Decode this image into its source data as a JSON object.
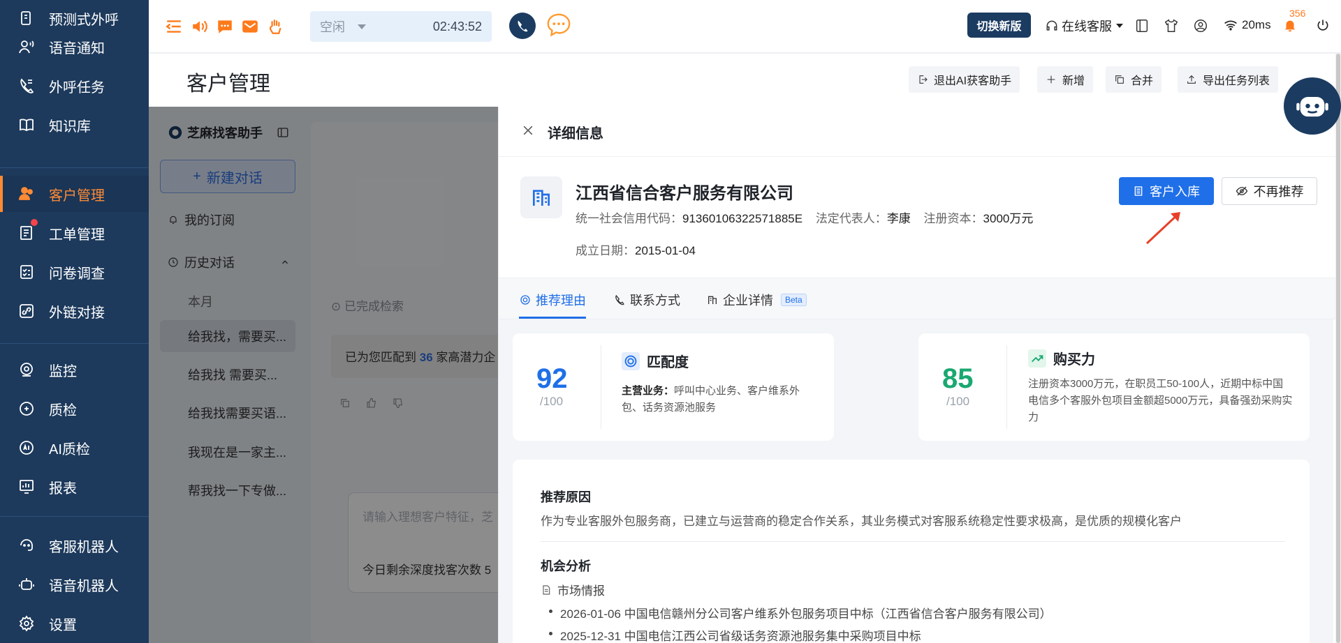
{
  "sidebar": {
    "items": [
      {
        "label": "预测式外呼",
        "icon": "predictive-dial-icon"
      },
      {
        "label": "语音通知",
        "icon": "voice-notice-icon"
      },
      {
        "label": "外呼任务",
        "icon": "outbound-task-icon"
      },
      {
        "label": "知识库",
        "icon": "book-icon"
      },
      {
        "label": "客户管理",
        "icon": "customers-icon",
        "active": true
      },
      {
        "label": "工单管理",
        "icon": "ticket-icon"
      },
      {
        "label": "问卷调查",
        "icon": "survey-icon"
      },
      {
        "label": "外链对接",
        "icon": "link-icon"
      },
      {
        "label": "监控",
        "icon": "monitor-icon"
      },
      {
        "label": "质检",
        "icon": "quality-icon"
      },
      {
        "label": "AI质检",
        "icon": "ai-quality-icon"
      },
      {
        "label": "报表",
        "icon": "report-icon"
      },
      {
        "label": "客服机器人",
        "icon": "service-bot-icon"
      },
      {
        "label": "语音机器人",
        "icon": "voice-bot-icon"
      },
      {
        "label": "设置",
        "icon": "gear-icon"
      }
    ]
  },
  "topbar": {
    "status": "空闲",
    "timer": "02:43:52",
    "switch_label": "切换新版",
    "online_service": "在线客服",
    "latency": "20ms",
    "notification_count": "356"
  },
  "header": {
    "title": "客户管理",
    "buttons": {
      "exit_ai": "退出AI获客助手",
      "add": "新增",
      "merge": "合并",
      "export": "导出任务列表"
    }
  },
  "assistant": {
    "title": "芝麻找客助手",
    "new_chat": "新建对话",
    "subscription": "我的订阅",
    "history": "历史对话",
    "month": "本月",
    "history_items": [
      "给我找，需要买...",
      "给我找 需要买...",
      "给我找需要买语...",
      "我现在是一家主...",
      "帮我找一下专做..."
    ],
    "done_text": "已完成检索",
    "result_prefix": "已为您匹配到",
    "result_count": "36",
    "result_suffix": "家高潜力企",
    "input_placeholder": "请输入理想客户特征，芝",
    "remaining": "今日剩余深度找客次数 5"
  },
  "drawer": {
    "title": "详细信息",
    "company": "江西省信合客户服务有限公司",
    "credit_code_label": "统一社会信用代码：",
    "credit_code": "91360106322571885E",
    "legal_rep_label": "法定代表人：",
    "legal_rep": "李康",
    "capital_label": "注册资本：",
    "capital": "3000万元",
    "founded_label": "成立日期：",
    "founded": "2015-01-04",
    "btn_add": "客户入库",
    "btn_skip": "不再推荐",
    "tabs": [
      "推荐理由",
      "联系方式",
      "企业详情"
    ],
    "beta": "Beta",
    "match": {
      "score": "92",
      "total": "/100",
      "title": "匹配度",
      "biz_label": "主营业务：",
      "biz_text": "呼叫中心业务、客户维系外包、话务资源池服务"
    },
    "purchase": {
      "score": "85",
      "total": "/100",
      "title": "购买力",
      "text": "注册资本3000万元，在职员工50-100人，近期中标中国电信多个客服外包项目金额超5000万元，具备强劲采购实力"
    },
    "reason_title": "推荐原因",
    "reason_text": "作为专业客服外包服务商，已建立与运营商的稳定合作关系，其业务模式对客服系统稳定性要求极高，是优质的规模化客户",
    "opportunity_title": "机会分析",
    "market_label": "市场情报",
    "market_items": [
      "2026-01-06 中国电信赣州分公司客户维系外包服务项目中标（江西省信合客户服务有限公司）",
      "2025-12-31 中国电信江西公司省级话务资源池服务集中采购项目中标"
    ]
  },
  "colors": {
    "sidebar_bg": "#1d3a5c",
    "accent": "#ff8a34",
    "primary": "#1f6fe8",
    "match_score": "#1f6fe8",
    "purchase_score": "#1aa871"
  }
}
